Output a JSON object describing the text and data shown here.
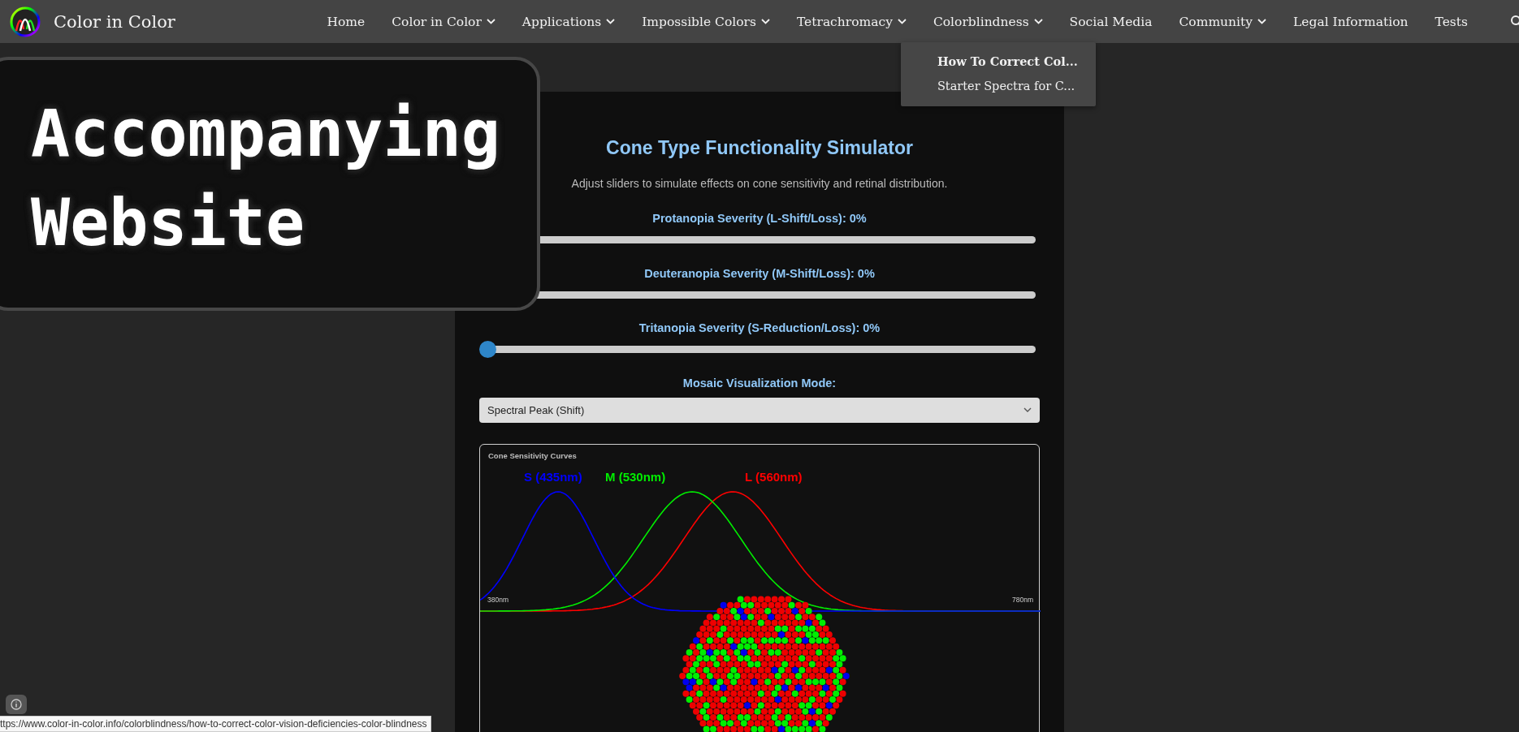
{
  "site": {
    "title": "Color in Color"
  },
  "nav": [
    {
      "label": "Home",
      "has_submenu": false
    },
    {
      "label": "Color in Color",
      "has_submenu": true
    },
    {
      "label": "Applications",
      "has_submenu": true
    },
    {
      "label": "Impossible Colors",
      "has_submenu": true
    },
    {
      "label": "Tetrachromacy",
      "has_submenu": true
    },
    {
      "label": "Colorblindness",
      "has_submenu": true,
      "submenu": [
        {
          "label": "How To Correct Col...",
          "selected": true
        },
        {
          "label": "Starter Spectra for C...",
          "selected": false
        }
      ]
    },
    {
      "label": "Social Media",
      "has_submenu": false
    },
    {
      "label": "Community",
      "has_submenu": true
    },
    {
      "label": "Legal Information",
      "has_submenu": false
    },
    {
      "label": "Tests",
      "has_submenu": false
    }
  ],
  "overlay_card": {
    "lines": [
      "Accompanying",
      "Website"
    ]
  },
  "simulator": {
    "title": "Cone Type Functionality Simulator",
    "subtitle": "Adjust sliders to simulate effects on cone sensitivity and retinal distribution.",
    "sliders": [
      {
        "label": "Protanopia Severity (L-Shift/Loss): 0%",
        "level": 0
      },
      {
        "label": "Deuteranopia Severity (M-Shift/Loss): 0%",
        "level": 0
      },
      {
        "label": "Tritanopia Severity (S-Reduction/Loss): 0%",
        "level": 0
      }
    ],
    "mode_label": "Mosaic Visualization Mode:",
    "mode_select": {
      "value": "Spectral Peak (Shift)"
    },
    "chart": {
      "title": "Cone Sensitivity Curves",
      "axis_start": "380nm",
      "axis_end": "780nm",
      "curves": [
        {
          "label": "S (435nm)",
          "color": "#0000ff"
        },
        {
          "label": "M (530nm)",
          "color": "#00ee00"
        },
        {
          "label": "L (560nm)",
          "color": "#ff0000"
        }
      ]
    }
  },
  "status_url": "ttps://www.color-in-color.info/colorblindness/how-to-correct-color-vision-deficiencies-color-blindness"
}
